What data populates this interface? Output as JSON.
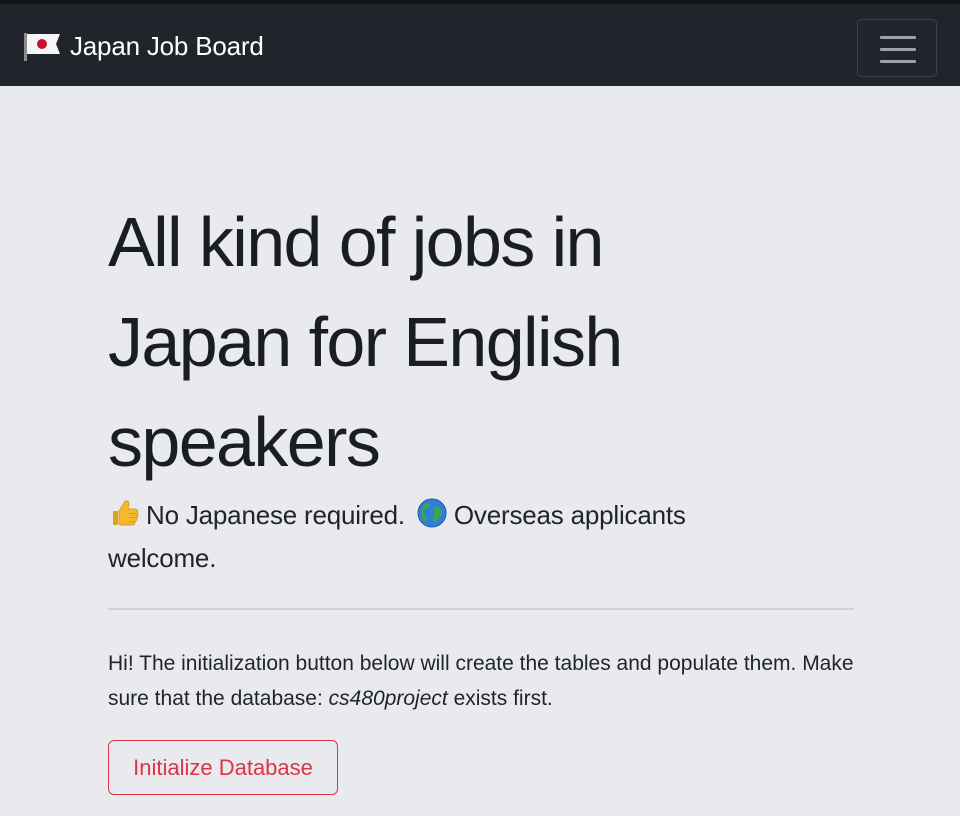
{
  "navbar": {
    "brand_text": "Japan Job Board",
    "brand_icon": "japan-flag-icon",
    "toggler_icon": "hamburger-menu-icon"
  },
  "hero": {
    "headline": "All kind of jobs in Japan for English speakers",
    "lead_part1": "No Japanese required.",
    "lead_part2": "Overseas applicants welcome.",
    "lead_icon1": "thumbs-up-emoji",
    "lead_icon2": "globe-emoji"
  },
  "intro": {
    "text_before": "Hi! The initialization button below will create the tables and populate them. Make sure that the database: ",
    "database_name": "cs480project",
    "text_after": " exists first."
  },
  "actions": {
    "initialize_label": "Initialize Database"
  },
  "colors": {
    "navbar_bg": "#21252b",
    "page_bg": "#e9eaee",
    "danger": "#dc3545"
  }
}
